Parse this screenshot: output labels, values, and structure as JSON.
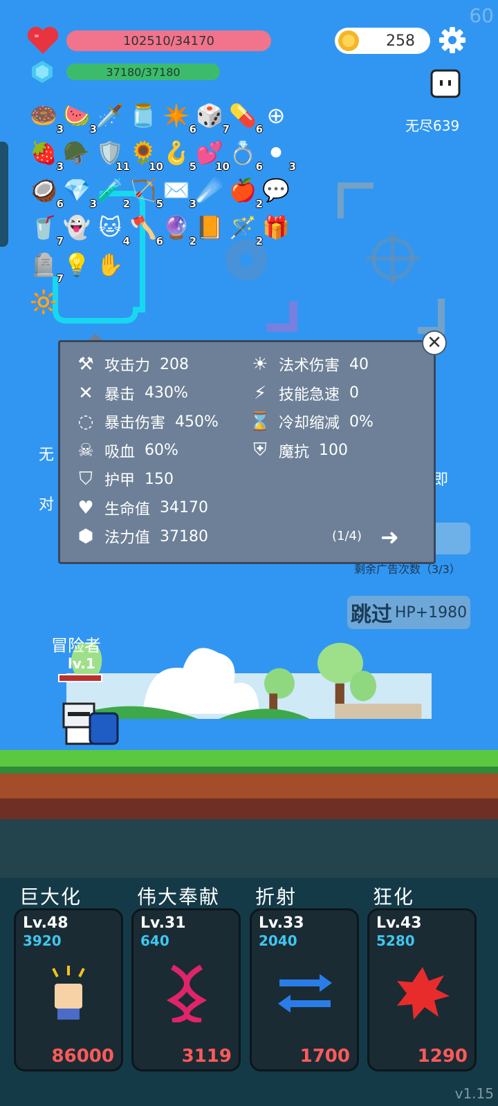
{
  "fps": "60",
  "version": "v1.15",
  "player": {
    "hp_text": "102510/34170",
    "mp_text": "37180/37180",
    "mp_fraction": 1.0
  },
  "coins": "258",
  "endless_label": "无尽639",
  "items": [
    {
      "icon": "donut-icon",
      "glyph": "🍩",
      "count": "3"
    },
    {
      "icon": "watermelon-icon",
      "glyph": "🍉",
      "count": "3"
    },
    {
      "icon": "sword-icon",
      "glyph": "🗡️",
      "count": ""
    },
    {
      "icon": "jam-jar-icon",
      "glyph": "🫙",
      "count": ""
    },
    {
      "icon": "spiked-mace-icon",
      "glyph": "✴️",
      "count": "6"
    },
    {
      "icon": "dice-icon",
      "glyph": "🎲",
      "count": "7"
    },
    {
      "icon": "pill-icon",
      "glyph": "💊",
      "count": "6"
    },
    {
      "icon": "crosshair-icon",
      "glyph": "⊕",
      "count": ""
    },
    {
      "icon": "strawberry-icon",
      "glyph": "🍓",
      "count": "3"
    },
    {
      "icon": "helmet-icon",
      "glyph": "🪖",
      "count": ""
    },
    {
      "icon": "shield-icon",
      "glyph": "🛡️",
      "count": "11"
    },
    {
      "icon": "sunflower-icon",
      "glyph": "🌻",
      "count": "10"
    },
    {
      "icon": "hook-icon",
      "glyph": "🪝",
      "count": "5"
    },
    {
      "icon": "hearts-icon",
      "glyph": "💕",
      "count": "10"
    },
    {
      "icon": "ring-icon",
      "glyph": "💍",
      "count": "6"
    },
    {
      "icon": "cauldron-icon",
      "glyph": "⚫",
      "count": "3"
    },
    {
      "icon": "coconut-icon",
      "glyph": "🥥",
      "count": "6"
    },
    {
      "icon": "gem-icon",
      "glyph": "💎",
      "count": "3"
    },
    {
      "icon": "potion-icon",
      "glyph": "🧪",
      "count": "2"
    },
    {
      "icon": "bow-icon",
      "glyph": "🏹",
      "count": "5"
    },
    {
      "icon": "envelope-icon",
      "glyph": "✉️",
      "count": "3"
    },
    {
      "icon": "meteor-icon",
      "glyph": "☄️",
      "count": ""
    },
    {
      "icon": "apple-icon",
      "glyph": "🍎",
      "count": "2"
    },
    {
      "icon": "chat-bubble-icon",
      "glyph": "💬",
      "count": ""
    },
    {
      "icon": "drink-icon",
      "glyph": "🥤",
      "count": "7"
    },
    {
      "icon": "ghost-icon",
      "glyph": "👻",
      "count": ""
    },
    {
      "icon": "cat-icon",
      "glyph": "🐱",
      "count": "4"
    },
    {
      "icon": "battle-axe-icon",
      "glyph": "🪓",
      "count": "6"
    },
    {
      "icon": "crystal-ball-icon",
      "glyph": "🔮",
      "count": "2"
    },
    {
      "icon": "spellbook-icon",
      "glyph": "📙",
      "count": ""
    },
    {
      "icon": "magic-wand-icon",
      "glyph": "🪄",
      "count": "2"
    },
    {
      "icon": "treasure-box-icon",
      "glyph": "🎁",
      "count": ""
    },
    {
      "icon": "tombstone-icon",
      "glyph": "🪦",
      "count": "7"
    },
    {
      "icon": "lightbulb-icon",
      "glyph": "💡",
      "count": ""
    },
    {
      "icon": "eye-hand-icon",
      "glyph": "✋",
      "count": ""
    },
    {
      "icon": "lamp-icon",
      "glyph": "🔆",
      "count": ""
    }
  ],
  "stats": {
    "left": [
      {
        "icon": "axe-icon",
        "glyph": "⚒",
        "label": "攻击力",
        "value": "208"
      },
      {
        "icon": "crit-icon",
        "glyph": "✕",
        "label": "暴击",
        "value": "430%"
      },
      {
        "icon": "crit-damage-icon",
        "glyph": "◌",
        "label": "暴击伤害",
        "value": "450%"
      },
      {
        "icon": "lifesteal-icon",
        "glyph": "☠",
        "label": "吸血",
        "value": "60%"
      },
      {
        "icon": "armor-icon",
        "glyph": "⛉",
        "label": "护甲",
        "value": "150"
      },
      {
        "icon": "heart-icon",
        "glyph": "♥",
        "label": "生命值",
        "value": "34170"
      },
      {
        "icon": "mana-icon",
        "glyph": "⬢",
        "label": "法力值",
        "value": "37180"
      }
    ],
    "right": [
      {
        "icon": "sun-icon",
        "glyph": "☀",
        "label": "法术伤害",
        "value": "40"
      },
      {
        "icon": "lightning-icon",
        "glyph": "⚡",
        "label": "技能急速",
        "value": "0"
      },
      {
        "icon": "hourglass-icon",
        "glyph": "⌛",
        "label": "冷却缩减",
        "value": "0%"
      },
      {
        "icon": "magic-resist-icon",
        "glyph": "⛨",
        "label": "魔抗",
        "value": "100"
      }
    ],
    "page": "(1/4)"
  },
  "partial_texts": {
    "left_1": "无",
    "left_2": "对",
    "right_1": "即",
    "remaining": "剩余广告次数（3/3）"
  },
  "skip": {
    "label": "跳过",
    "bonus": "HP+1980"
  },
  "hero": {
    "name": "冒险者",
    "level": "lv.1"
  },
  "skills": [
    {
      "title": "巨大化",
      "level": "Lv.48",
      "value": "3920",
      "cost": "86000",
      "icon": "fist-icon"
    },
    {
      "title": "伟大奉献",
      "level": "Lv.31",
      "value": "640",
      "cost": "3119",
      "icon": "dna-icon"
    },
    {
      "title": "折射",
      "level": "Lv.33",
      "value": "2040",
      "cost": "1700",
      "icon": "refraction-arrows-icon"
    },
    {
      "title": "狂化",
      "level": "Lv.43",
      "value": "5280",
      "cost": "1290",
      "icon": "berserk-splat-icon"
    }
  ]
}
